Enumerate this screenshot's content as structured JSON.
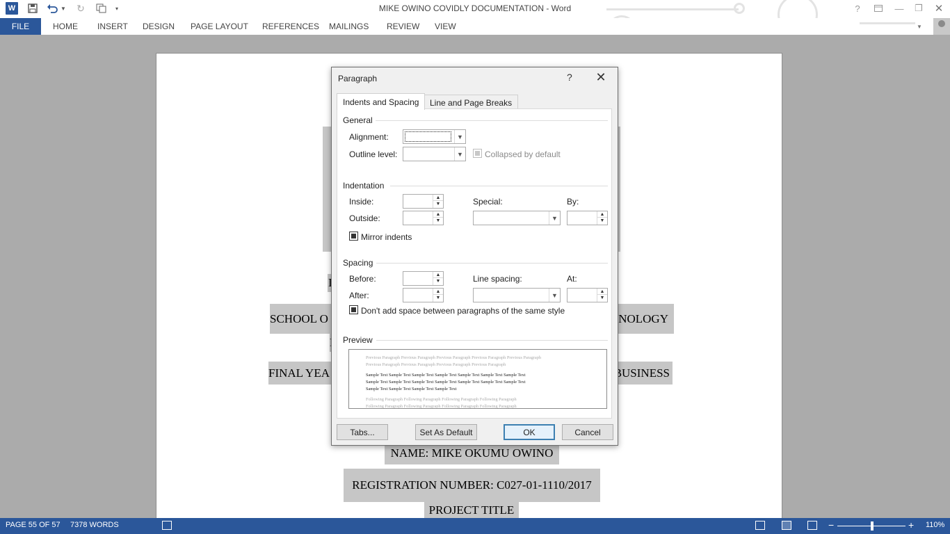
{
  "window": {
    "title": "MIKE OWINO COVIDLY DOCUMENTATION - Word",
    "quick_access": [
      "word-logo",
      "save-icon",
      "undo-icon",
      "undo-dropdown-icon",
      "redo-icon",
      "touch-mode-icon",
      "customize-qat-icon"
    ],
    "controls": [
      "help-icon",
      "ribbon-display-icon",
      "minimize-icon",
      "restore-icon",
      "close-icon"
    ]
  },
  "ribbon": {
    "file": "FILE",
    "tabs": [
      "HOME",
      "INSERT",
      "DESIGN",
      "PAGE LAYOUT",
      "REFERENCES",
      "MAILINGS",
      "REVIEW",
      "VIEW"
    ]
  },
  "document": {
    "lines": [
      {
        "text": "",
        "note": "blank highlighted block"
      },
      {
        "text": "I"
      },
      {
        "text": "SCHOOL O",
        "right": "NOLOGY"
      },
      {
        "text": "F"
      },
      {
        "text": "FINAL YEA",
        "right": "BUSINESS"
      },
      {
        "text": "NAME: MIKE OKUMU OWINO"
      },
      {
        "text": "REGISTRATION NUMBER: C027-01-1110/2017"
      },
      {
        "text": "PROJECT TITLE"
      }
    ]
  },
  "status": {
    "page": "PAGE 55 OF 57",
    "words": "7378 WORDS",
    "zoom": "110%",
    "zoom_level_percent": 110
  },
  "dialog": {
    "title": "Paragraph",
    "help": "?",
    "close": "✕",
    "tabs": {
      "indents": "Indents and Spacing",
      "breaks": "Line and Page Breaks"
    },
    "general": {
      "heading": "General",
      "alignment_label": "Alignment:",
      "alignment_value": "",
      "outline_label": "Outline level:",
      "outline_value": "",
      "collapsed_label": "Collapsed by default"
    },
    "indentation": {
      "heading": "Indentation",
      "inside_label": "Inside:",
      "inside_value": "",
      "outside_label": "Outside:",
      "outside_value": "",
      "special_label": "Special:",
      "special_value": "",
      "by_label": "By:",
      "by_value": "",
      "mirror_label": "Mirror indents"
    },
    "spacing": {
      "heading": "Spacing",
      "before_label": "Before:",
      "before_value": "",
      "after_label": "After:",
      "after_value": "",
      "line_spacing_label": "Line spacing:",
      "line_spacing_value": "",
      "at_label": "At:",
      "at_value": "",
      "dont_add_label": "Don't add space between paragraphs of the same style"
    },
    "preview": {
      "heading": "Preview",
      "previous": [
        "Previous Paragraph Previous Paragraph Previous Paragraph Previous Paragraph Previous Paragraph",
        "Previous Paragraph Previous Paragraph Previous Paragraph Previous Paragraph"
      ],
      "sample": [
        "Sample Text Sample Text Sample Text Sample Text Sample Text Sample Text Sample Text",
        "Sample Text Sample Text Sample Text Sample Text Sample Text Sample Text Sample Text",
        "Sample Text Sample Text Sample Text Sample Text"
      ],
      "following": [
        "Following Paragraph Following Paragraph Following Paragraph Following Paragraph",
        "Following Paragraph Following Paragraph Following Paragraph Following Paragraph"
      ]
    },
    "buttons": {
      "tabs": "Tabs...",
      "set_default": "Set As Default",
      "ok": "OK",
      "cancel": "Cancel"
    }
  }
}
